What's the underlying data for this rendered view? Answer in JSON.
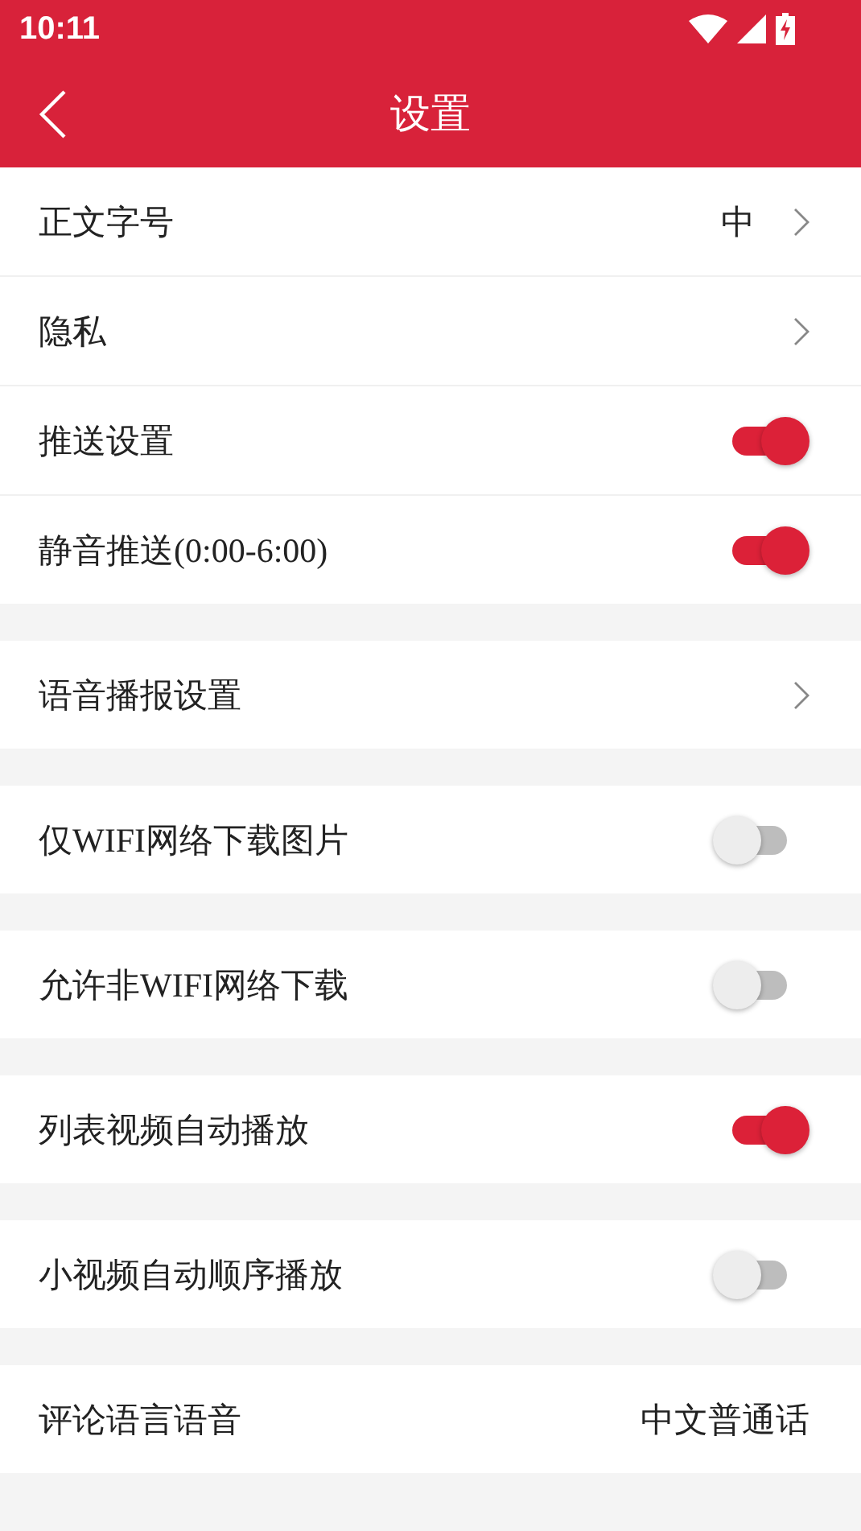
{
  "status_bar": {
    "time": "10:11"
  },
  "app_bar": {
    "title": "设置"
  },
  "groups": [
    {
      "rows": [
        {
          "kind": "link",
          "label": "正文字号",
          "value": "中"
        },
        {
          "kind": "link",
          "label": "隐私"
        },
        {
          "kind": "toggle",
          "label": "推送设置",
          "on": true
        },
        {
          "kind": "toggle",
          "label": "静音推送(0:00-6:00)",
          "on": true
        }
      ]
    },
    {
      "rows": [
        {
          "kind": "link",
          "label": "语音播报设置"
        }
      ]
    },
    {
      "rows": [
        {
          "kind": "toggle",
          "label": "仅WIFI网络下载图片",
          "on": false
        }
      ]
    },
    {
      "rows": [
        {
          "kind": "toggle",
          "label": "允许非WIFI网络下载",
          "on": false
        }
      ]
    },
    {
      "rows": [
        {
          "kind": "toggle",
          "label": "列表视频自动播放",
          "on": true
        }
      ]
    },
    {
      "rows": [
        {
          "kind": "toggle",
          "label": "小视频自动顺序播放",
          "on": false
        }
      ]
    },
    {
      "rows": [
        {
          "kind": "text",
          "label": "评论语言语音",
          "value": "中文普通话"
        }
      ]
    }
  ]
}
